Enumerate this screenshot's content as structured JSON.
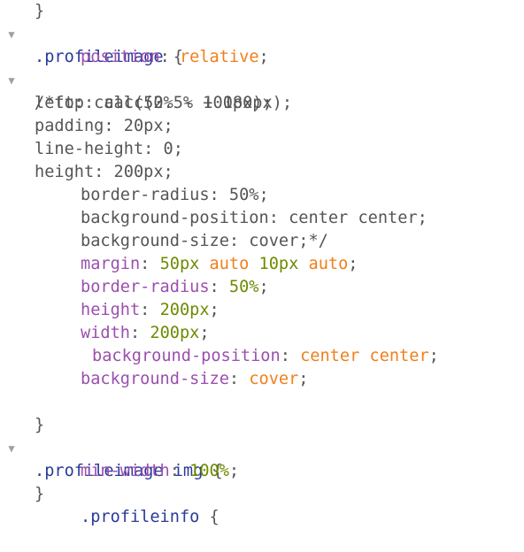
{
  "colors": {
    "selector": "#2a3a9a",
    "property": "#9b4fae",
    "keyword": "#f07f1b",
    "number": "#6b8b00",
    "plain": "#555555",
    "fold_arrow": "#9aa0a6"
  },
  "fold_icon": "triangle-down-icon",
  "lines": {
    "l0": {
      "brace": "}"
    },
    "l1": {
      "fold": "▼",
      "selector": ".profileimage",
      "brace": " {"
    },
    "l2": {
      "prop": "position",
      "colon": ": ",
      "kw": "relative",
      "semi": ";"
    },
    "l3": {
      "fold": "▼",
      "text": "/*top: calc(2.5% + 180px);"
    },
    "l4": {
      "text": "left: calc(50% - 100px);"
    },
    "l5": {
      "text": "padding: 20px;"
    },
    "l6": {
      "text": "line-height: 0;"
    },
    "l7": {
      "text": "height: 200px;"
    },
    "l8": {
      "text": "border-radius: 50%;"
    },
    "l9": {
      "text": "background-position: center center;"
    },
    "l10": {
      "text": "background-size: cover;*/"
    },
    "l11": {
      "prop": "margin",
      "colon": ": ",
      "v1": "50px",
      "s1": " ",
      "v2": "auto",
      "s2": " ",
      "v3": "10px",
      "s3": " ",
      "v4": "auto",
      "semi": ";"
    },
    "l12": {
      "prop": "border-radius",
      "colon": ": ",
      "num": "50%",
      "semi": ";"
    },
    "l13": {
      "prop": "height",
      "colon": ": ",
      "num": "200px",
      "semi": ";"
    },
    "l14": {
      "prop": "width",
      "colon": ": ",
      "num": "200px",
      "semi": ";"
    },
    "l15": {
      "prop": "background-position",
      "colon": ": ",
      "kw1": "center",
      "sp": " ",
      "kw2": "center",
      "semi": ";"
    },
    "l16": {
      "prop": "background-size",
      "colon": ": ",
      "kw": "cover",
      "semi": ";"
    },
    "l17": {
      "text": ""
    },
    "l18": {
      "brace": "}"
    },
    "l19": {
      "fold": "▼",
      "selector": ".profileimage img",
      "brace": " {"
    },
    "l20": {
      "prop": "min-width",
      "colon": ": ",
      "num": "100%",
      "semi": ";"
    },
    "l21": {
      "brace": "}"
    },
    "l22": {
      "selector": ".profileinfo",
      "brace": " {"
    }
  }
}
